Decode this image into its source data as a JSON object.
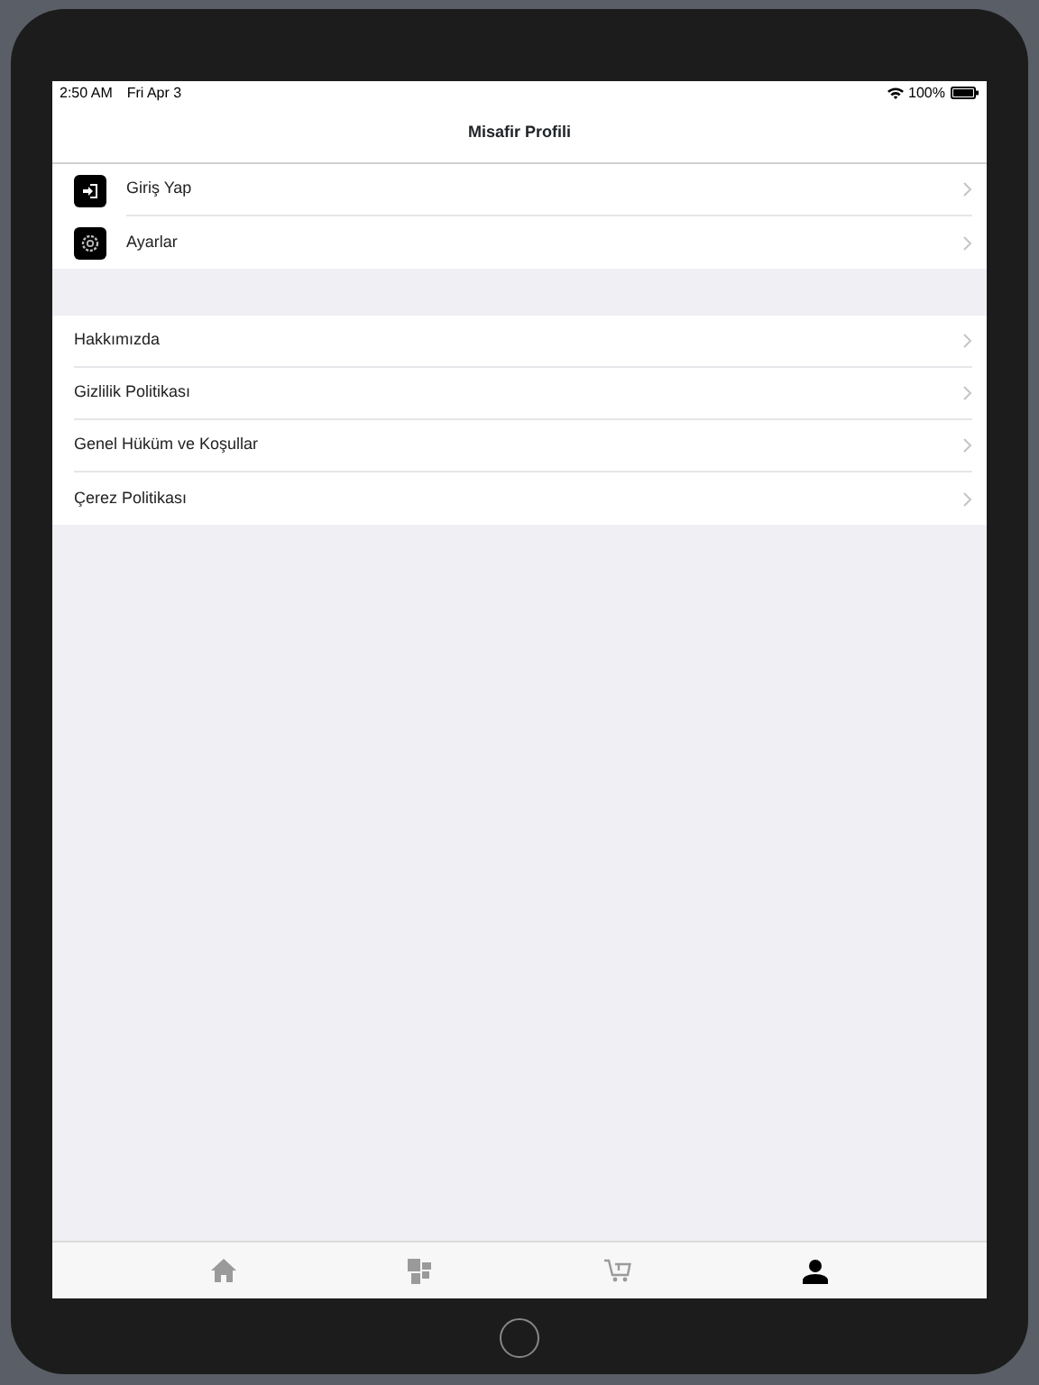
{
  "status_bar": {
    "time": "2:50 AM",
    "date": "Fri Apr 3",
    "battery": "100%"
  },
  "nav_bar": {
    "title": "Misafir Profili"
  },
  "sections": [
    {
      "rows": [
        {
          "label": "Giriş Yap",
          "kind": "login"
        },
        {
          "label": "Ayarlar",
          "kind": "settings"
        }
      ]
    },
    {
      "rows": [
        {
          "label": "Hakkımızda",
          "kind": "plain"
        },
        {
          "label": "Gizlilik Politikası",
          "kind": "plain"
        },
        {
          "label": "Genel Hüküm ve Koşullar",
          "kind": "plain"
        },
        {
          "label": "Çerez Politikası",
          "kind": "plain"
        }
      ]
    }
  ],
  "tab_bar": [
    {
      "kind": "home",
      "selected": false
    },
    {
      "kind": "categories",
      "selected": false
    },
    {
      "kind": "cart",
      "selected": false
    },
    {
      "kind": "profile",
      "selected": true
    }
  ]
}
